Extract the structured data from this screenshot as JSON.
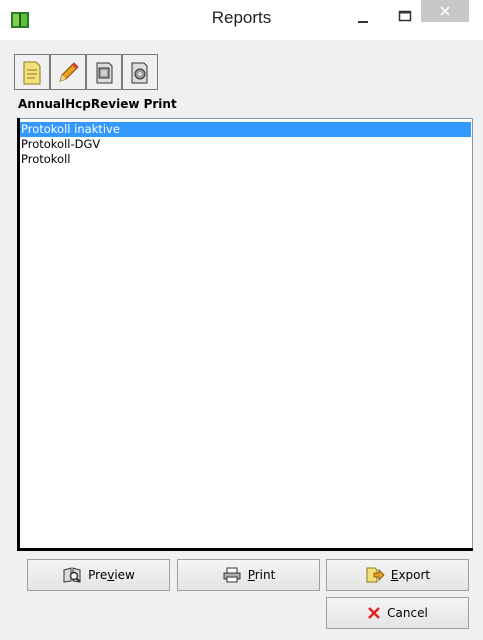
{
  "window": {
    "title": "Reports",
    "controls": {
      "minimize": "minimize-icon",
      "maximize": "maximize-icon",
      "close": "close-icon"
    }
  },
  "toolbar": {
    "buttons": [
      {
        "icon": "new-report-icon"
      },
      {
        "icon": "edit-pencil-icon"
      },
      {
        "icon": "report-template-icon"
      },
      {
        "icon": "report-designer-icon"
      }
    ]
  },
  "report_group": {
    "heading": "AnnualHcpReview Print",
    "items": [
      {
        "label": "Protokoll inaktive",
        "selected": true
      },
      {
        "label": "Protokoll-DGV",
        "selected": false
      },
      {
        "label": "Protokoll",
        "selected": false
      }
    ]
  },
  "buttons": {
    "preview": {
      "label_pre": "Pre",
      "label_mnemonic": "v",
      "label_post": "iew",
      "icon": "preview-icon"
    },
    "print": {
      "label_mnemonic": "P",
      "label_post": "rint",
      "icon": "printer-icon"
    },
    "export": {
      "label_mnemonic": "E",
      "label_post": "xport",
      "icon": "export-icon"
    },
    "cancel": {
      "label": "Cancel",
      "icon": "cancel-x-icon"
    }
  },
  "colors": {
    "selection": "#3399ff",
    "cancel_icon": "#e02020",
    "window_background": "#f0f0f0"
  }
}
